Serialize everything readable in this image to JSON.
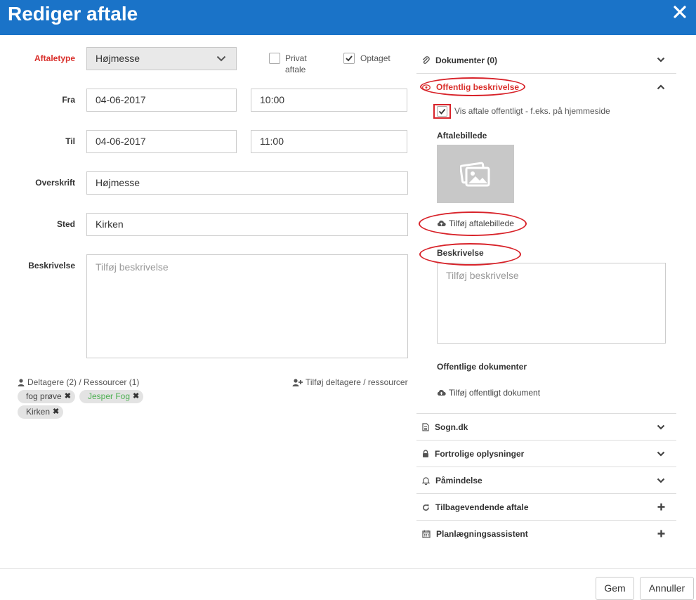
{
  "header": {
    "title": "Rediger aftale",
    "close_icon": "close-icon"
  },
  "form": {
    "type_label": "Aftaletype",
    "type_value": "Højmesse",
    "private_label_1": "Privat",
    "private_label_2": "aftale",
    "private_checked": false,
    "busy_label": "Optaget",
    "busy_checked": true,
    "from_label": "Fra",
    "from_date": "04-06-2017",
    "from_time": "10:00",
    "to_label": "Til",
    "to_date": "04-06-2017",
    "to_time": "11:00",
    "title_label": "Overskrift",
    "title_value": "Højmesse",
    "place_label": "Sted",
    "place_value": "Kirken",
    "desc_label": "Beskrivelse",
    "desc_placeholder": "Tilføj beskrivelse"
  },
  "participants": {
    "summary": "Deltagere (2) / Ressourcer (1)",
    "add_label": "Tilføj deltagere / ressourcer",
    "tags": [
      {
        "label": "fog prøve",
        "color": "#444444"
      },
      {
        "label": "Jesper Fog",
        "color": "#4caf50"
      },
      {
        "label": "Kirken",
        "color": "#444444"
      }
    ]
  },
  "accordion": {
    "documents": "Dokumenter (0)",
    "public_desc": "Offentlig beskrivelse",
    "show_public_label": "Vis aftale offentligt - f.eks. på hjemmeside",
    "show_public_checked": true,
    "image_label": "Aftalebillede",
    "add_image": "Tilføj aftalebillede",
    "desc_label": "Beskrivelse",
    "desc_placeholder": "Tilføj beskrivelse",
    "public_docs_label": "Offentlige dokumenter",
    "add_public_doc": "Tilføj offentligt dokument",
    "sogn": "Sogn.dk",
    "confidential": "Fortrolige oplysninger",
    "reminder": "Påmindelse",
    "recurring": "Tilbagevendende aftale",
    "planner": "Planlægningsassistent"
  },
  "footer": {
    "save": "Gem",
    "cancel": "Annuller"
  },
  "colors": {
    "header_bg": "#1a73c8",
    "required_label": "#d9302c",
    "annotation_ring": "#d8232a"
  }
}
